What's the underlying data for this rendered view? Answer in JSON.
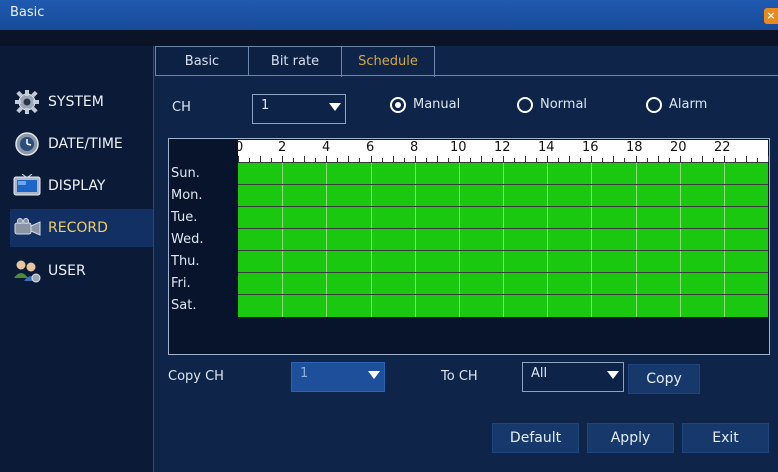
{
  "window": {
    "title": "Basic",
    "close_icon": "close-icon"
  },
  "sidebar": {
    "items": [
      {
        "label": "SYSTEM",
        "icon": "gear-icon"
      },
      {
        "label": "DATE/TIME",
        "icon": "clock-icon"
      },
      {
        "label": "DISPLAY",
        "icon": "monitor-icon"
      },
      {
        "label": "RECORD",
        "icon": "camera-icon",
        "active": true
      },
      {
        "label": "USER",
        "icon": "users-icon"
      }
    ]
  },
  "tabs": [
    {
      "label": "Basic"
    },
    {
      "label": "Bit rate"
    },
    {
      "label": "Schedule",
      "active": true
    }
  ],
  "schedule": {
    "ch_label": "CH",
    "ch_value": "1",
    "modes": [
      {
        "label": "Manual",
        "selected": true
      },
      {
        "label": "Normal",
        "selected": false
      },
      {
        "label": "Alarm",
        "selected": false
      }
    ],
    "hours": [
      "0",
      "2",
      "4",
      "6",
      "8",
      "10",
      "12",
      "14",
      "16",
      "18",
      "20",
      "22"
    ],
    "days": [
      "Sun.",
      "Mon.",
      "Tue.",
      "Wed.",
      "Thu.",
      "Fri.",
      "Sat."
    ],
    "record_color": "#19c80f",
    "copy_ch_label": "Copy CH",
    "copy_ch_value": "1",
    "to_ch_label": "To CH",
    "to_ch_value": "All",
    "copy_button": "Copy"
  },
  "footer": {
    "default_button": "Default",
    "apply_button": "Apply",
    "exit_button": "Exit"
  }
}
